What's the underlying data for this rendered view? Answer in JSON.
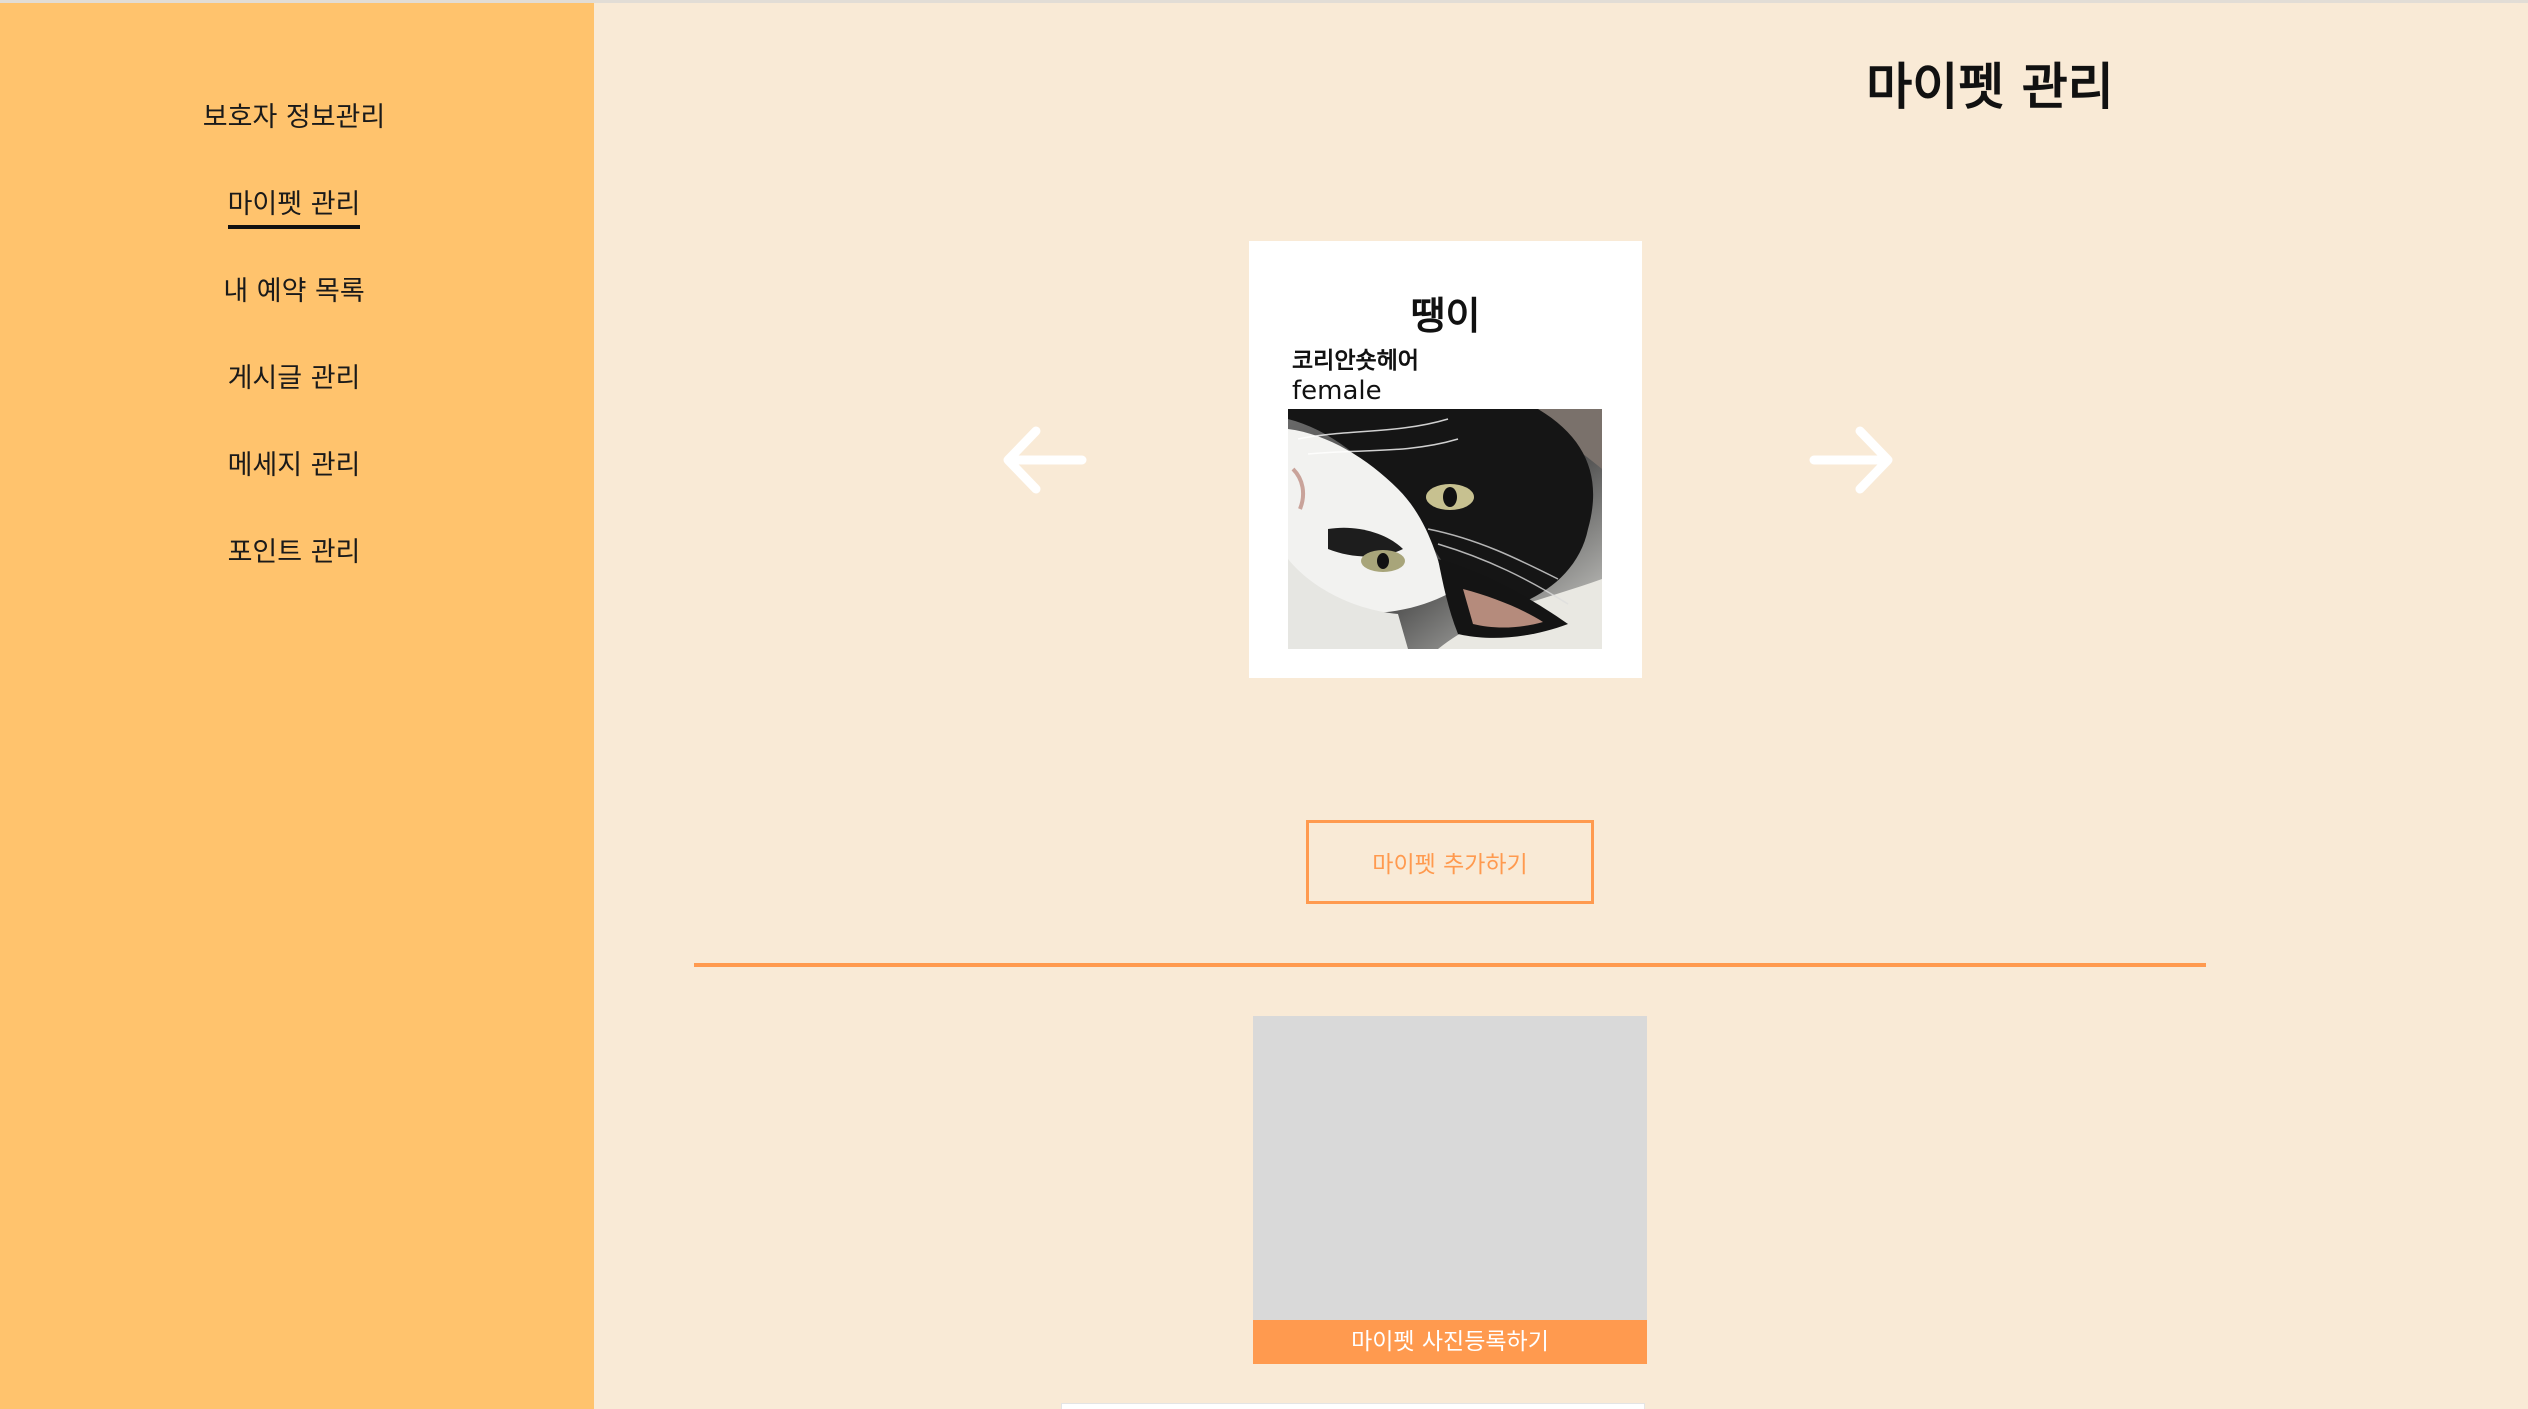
{
  "sidebar": {
    "items": [
      {
        "label": "보호자 정보관리"
      },
      {
        "label": "마이펫 관리",
        "active": true
      },
      {
        "label": "내 예약 목록"
      },
      {
        "label": "게시글 관리"
      },
      {
        "label": "메세지 관리"
      },
      {
        "label": "포인트 관리"
      }
    ]
  },
  "main": {
    "title": "마이펫 관리",
    "carousel": {
      "prev_icon": "arrow-left-icon",
      "next_icon": "arrow-right-icon"
    },
    "pet": {
      "name": "땡이",
      "breed": "코리안숏헤어",
      "gender": "female",
      "photo_icon": "cat-photo"
    },
    "add_pet_label": "마이펫 추가하기",
    "photo_upload_label": "마이펫 사진등록하기"
  },
  "colors": {
    "sidebar_bg": "#ffc36d",
    "page_bg": "#f9ead6",
    "accent": "#ff9a4f",
    "card_bg": "#ffffff",
    "placeholder_bg": "#d9d9d9"
  }
}
